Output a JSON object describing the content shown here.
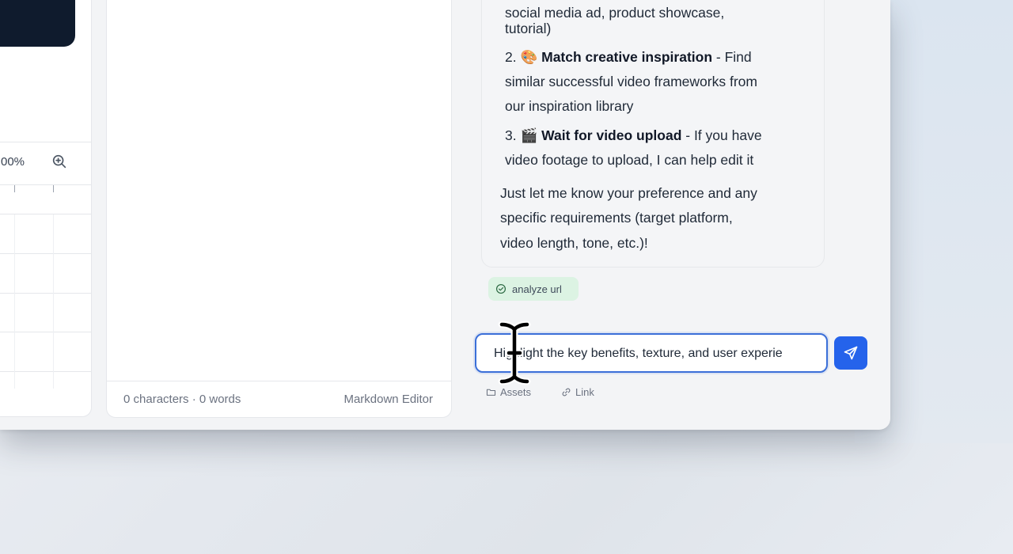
{
  "left_panel": {
    "zoom_text": "00%",
    "zoom_icon": "zoom-in-icon"
  },
  "editor": {
    "count_text": "0 characters · 0 words",
    "mode_label": "Markdown Editor"
  },
  "chat": {
    "message_lines": {
      "l1": "social media ad, product showcase,",
      "l2": "tutorial)",
      "item2_num": "2. 🎨",
      "item2_bold": "Match creative inspiration",
      "item2_rest": " - Find",
      "l4": "similar successful video frameworks from",
      "l5": "our inspiration library",
      "item3_num": "3. 🎬",
      "item3_bold": "Wait for video upload",
      "item3_rest": " - If you have",
      "l7": "video footage to upload, I can help edit it",
      "l8": "Just let me know your preference and any",
      "l9": "specific requirements (target platform,",
      "l10": "video length, tone, etc.)!"
    },
    "tag": {
      "label": "analyze url",
      "icon": "check-circle-icon"
    },
    "input": {
      "value": "Highlight the key benefits, texture, and user experie"
    },
    "send_icon": "send-icon",
    "attachments": {
      "assets_label": "Assets",
      "assets_icon": "folder-icon",
      "link_label": "Link",
      "link_icon": "link-icon"
    }
  },
  "colors": {
    "accent": "#2563eb",
    "tag_bg": "#dcf3e3",
    "dark_card": "#0f1b2d"
  }
}
